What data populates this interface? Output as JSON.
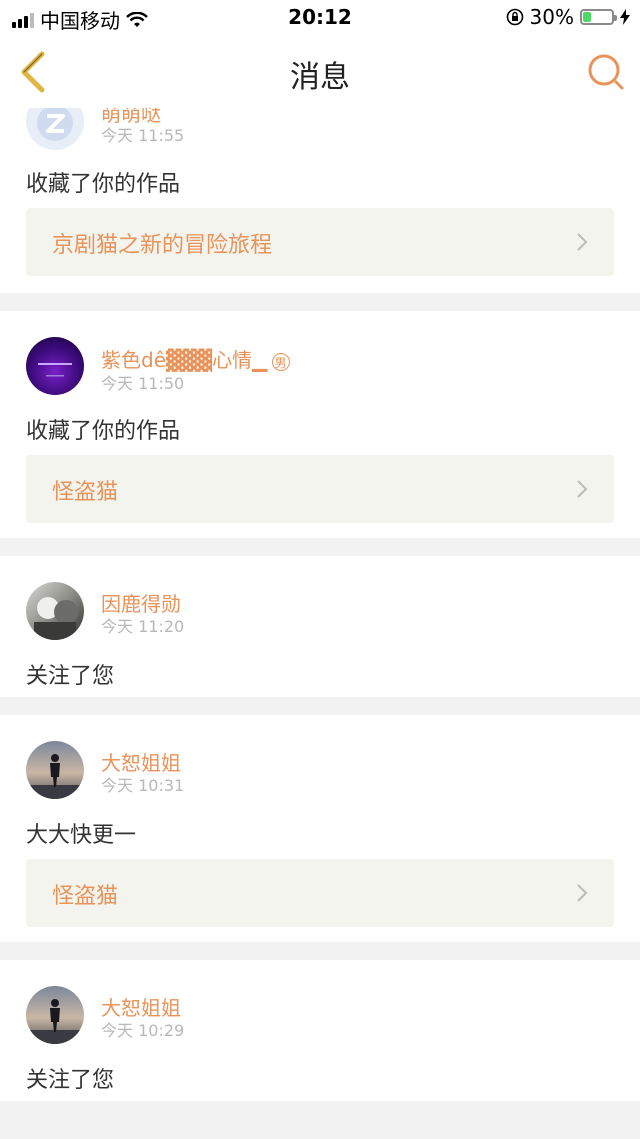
{
  "status_bar": {
    "carrier": "中国移动",
    "time": "20:12",
    "battery_percent": "30%",
    "battery_level": 0.3,
    "icons": [
      "signal-icon",
      "wifi-icon",
      "rotation-lock-icon",
      "battery-icon",
      "charging-icon"
    ]
  },
  "nav": {
    "title": "消息",
    "back_icon": "chevron-left-icon",
    "search_icon": "search-icon",
    "accent_color": "#e8935a"
  },
  "messages": [
    {
      "user": "萌萌哒",
      "time": "今天 11:55",
      "action": "收藏了你的作品",
      "work": "京剧猫之新的冒险旅程"
    },
    {
      "user": "紫色dê▓▓▓心情▁",
      "gender": "男",
      "time": "今天 11:50",
      "action": "收藏了你的作品",
      "work": "怪盗猫"
    },
    {
      "user": "因鹿得勋",
      "time": "今天 11:20",
      "action": "关注了您"
    },
    {
      "user": "大恕姐姐",
      "time": "今天 10:31",
      "action": "大大快更一",
      "work": "怪盗猫"
    },
    {
      "user": "大恕姐姐",
      "time": "今天 10:29",
      "action": "关注了您"
    }
  ]
}
